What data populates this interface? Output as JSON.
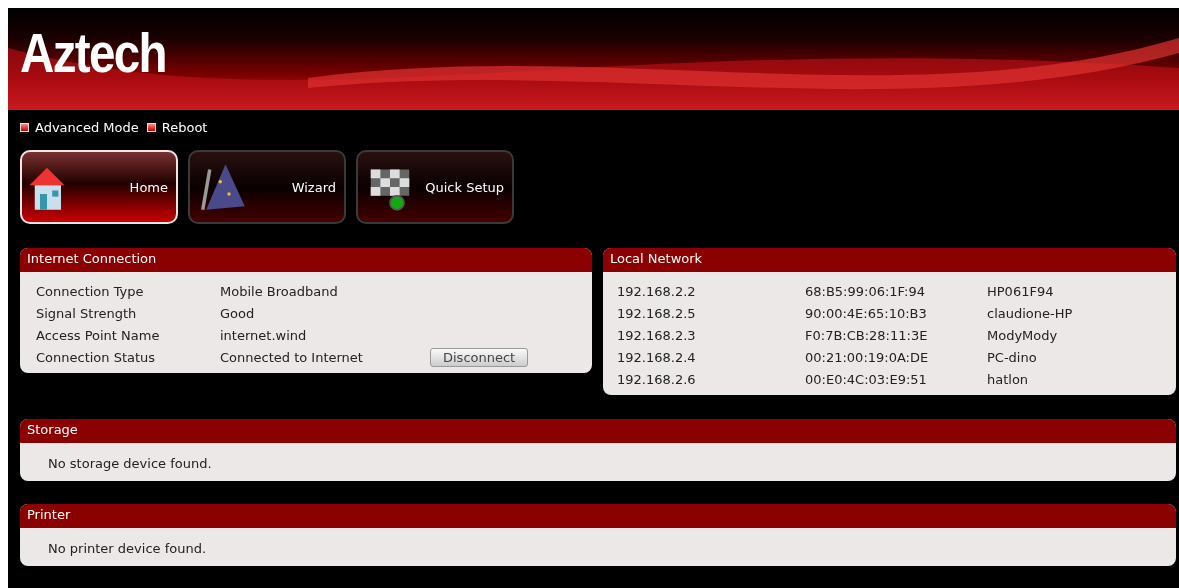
{
  "header": {
    "logo": "Aztech"
  },
  "top_links": [
    {
      "label": "Advanced Mode"
    },
    {
      "label": "Reboot"
    }
  ],
  "nav_buttons": [
    {
      "label": "Home",
      "kind": "home",
      "selected": true
    },
    {
      "label": "Wizard",
      "kind": "wizard",
      "selected": false
    },
    {
      "label": "Quick Setup",
      "kind": "quick",
      "selected": false
    }
  ],
  "internet_connection": {
    "title": "Internet Connection",
    "rows": [
      {
        "label": "Connection Type",
        "value": "Mobile Broadband"
      },
      {
        "label": "Signal Strength",
        "value": "Good"
      },
      {
        "label": "Access Point Name",
        "value": "internet.wind"
      },
      {
        "label": "Connection Status",
        "value": "Connected to Internet",
        "button": "Disconnect"
      }
    ]
  },
  "local_network": {
    "title": "Local Network",
    "rows": [
      {
        "ip": "192.168.2.2",
        "mac": "68:B5:99:06:1F:94",
        "name": "HP061F94"
      },
      {
        "ip": "192.168.2.5",
        "mac": "90:00:4E:65:10:B3",
        "name": "claudione-HP"
      },
      {
        "ip": "192.168.2.3",
        "mac": "F0:7B:CB:28:11:3E",
        "name": "ModyMody"
      },
      {
        "ip": "192.168.2.4",
        "mac": "00:21:00:19:0A:DE",
        "name": "PC-dino"
      },
      {
        "ip": "192.168.2.6",
        "mac": "00:E0:4C:03:E9:51",
        "name": "hatlon"
      }
    ]
  },
  "storage": {
    "title": "Storage",
    "message": "No storage device found."
  },
  "printer": {
    "title": "Printer",
    "message": "No printer device found."
  }
}
